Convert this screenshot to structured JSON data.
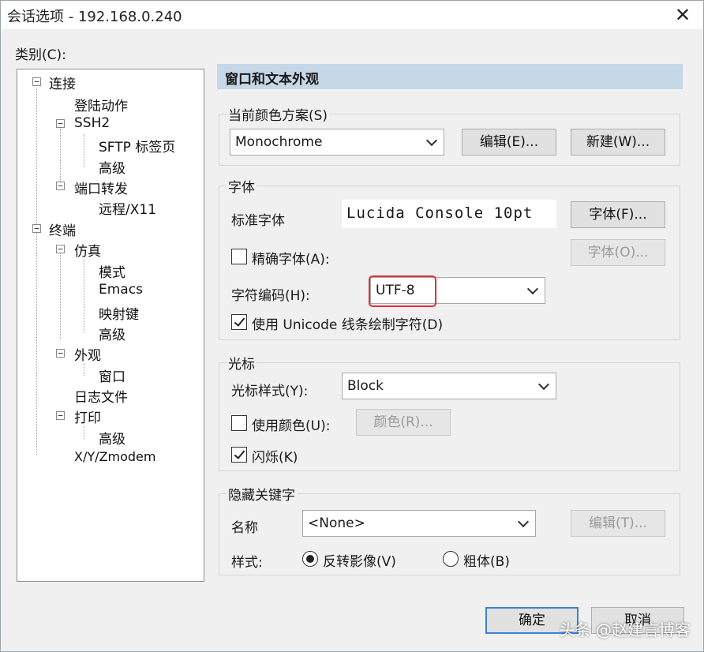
{
  "window": {
    "title": "会话选项 - 192.168.0.240",
    "close_glyph": "✕"
  },
  "category": {
    "label": "类别(C):",
    "tree": [
      {
        "label": "连接"
      },
      {
        "label": "登陆动作"
      },
      {
        "label": "SSH2"
      },
      {
        "label": "SFTP 标签页"
      },
      {
        "label": "高级"
      },
      {
        "label": "端口转发"
      },
      {
        "label": "远程/X11"
      },
      {
        "label": "终端"
      },
      {
        "label": "仿真"
      },
      {
        "label": "模式"
      },
      {
        "label": "Emacs"
      },
      {
        "label": "映射键"
      },
      {
        "label": "高级"
      },
      {
        "label": "外观"
      },
      {
        "label": "窗口"
      },
      {
        "label": "日志文件"
      },
      {
        "label": "打印"
      },
      {
        "label": "高级"
      },
      {
        "label": "X/Y/Zmodem"
      }
    ]
  },
  "panel": {
    "header": "窗口和文本外观",
    "color_scheme": {
      "title": "当前颜色方案(S)",
      "value": "Monochrome",
      "edit_button": "编辑(E)...",
      "new_button": "新建(W)..."
    },
    "font": {
      "title": "字体",
      "standard_label": "标准字体",
      "standard_value": "Lucida Console 10pt",
      "font_button": "字体(F)...",
      "precise_label": "精确字体(A):",
      "precise_checked": false,
      "precise_button": "字体(O)...",
      "encoding_label": "字符编码(H):",
      "encoding_value": "UTF-8",
      "unicode_label": "使用 Unicode 线条绘制字符(D)",
      "unicode_checked": true
    },
    "cursor": {
      "title": "光标",
      "style_label": "光标样式(Y):",
      "style_value": "Block",
      "use_color_label": "使用颜色(U):",
      "use_color_checked": false,
      "color_button": "颜色(R)...",
      "blink_label": "闪烁(K)",
      "blink_checked": true
    },
    "keywords": {
      "title": "隐藏关键字",
      "name_label": "名称",
      "name_value": "<None>",
      "edit_button": "编辑(T)...",
      "style_label": "样式:",
      "reverse_label": "反转影像(V)",
      "bold_label": "粗体(B)",
      "selected": "reverse"
    }
  },
  "footer": {
    "ok_button": "确定",
    "cancel_button": "取消",
    "watermark": "头条 @赵建言博客"
  },
  "colors": {
    "header_bg": "#c6d7e8",
    "highlight": "#e0303a",
    "default_button_border": "#3c7fd9"
  }
}
